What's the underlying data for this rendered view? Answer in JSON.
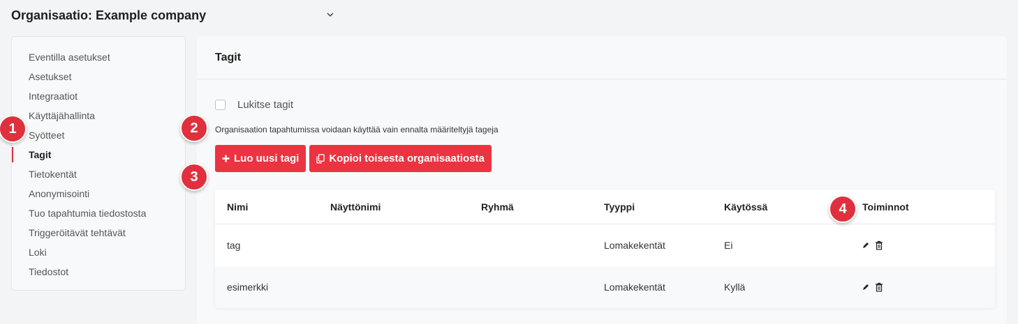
{
  "org": {
    "title": "Organisaatio: Example company",
    "chevron_icon": "chevron-down-icon"
  },
  "sidebar": {
    "items": [
      {
        "label": "Eventilla asetukset",
        "active": false
      },
      {
        "label": "Asetukset",
        "active": false
      },
      {
        "label": "Integraatiot",
        "active": false
      },
      {
        "label": "Käyttäjähallinta",
        "active": false
      },
      {
        "label": "Syötteet",
        "active": false
      },
      {
        "label": "Tagit",
        "active": true
      },
      {
        "label": "Tietokentät",
        "active": false
      },
      {
        "label": "Anonymisointi",
        "active": false
      },
      {
        "label": "Tuo tapahtumia tiedostosta",
        "active": false
      },
      {
        "label": "Triggeröitävät tehtävät",
        "active": false
      },
      {
        "label": "Loki",
        "active": false
      },
      {
        "label": "Tiedostot",
        "active": false
      }
    ]
  },
  "main": {
    "title": "Tagit",
    "lock": {
      "label": "Lukitse tagit",
      "checked": false
    },
    "description": "Organisaation tapahtumissa voidaan käyttää vain ennalta määriteltyjä tageja",
    "buttons": {
      "create": {
        "label": "Luo uusi tagi",
        "icon": "plus-icon"
      },
      "copy": {
        "label": "Kopioi toisesta organisaatiosta",
        "icon": "copy-icon"
      }
    },
    "table": {
      "headers": [
        "Nimi",
        "Näyttönimi",
        "Ryhmä",
        "Tyyppi",
        "Käytössä",
        "Toiminnot"
      ],
      "rows": [
        {
          "nimi": "tag",
          "nayttonimi": "",
          "ryhma": "",
          "tyyppi": "Lomakekentät",
          "kaytossa": "Ei"
        },
        {
          "nimi": "esimerkki",
          "nayttonimi": "",
          "ryhma": "",
          "tyyppi": "Lomakekentät",
          "kaytossa": "Kyllä"
        }
      ],
      "action_icons": [
        "edit-icon",
        "trash-icon"
      ]
    }
  },
  "markers": [
    "1",
    "2",
    "3",
    "4"
  ],
  "colors": {
    "accent": "#ec3342",
    "marker": "#e0303e"
  }
}
